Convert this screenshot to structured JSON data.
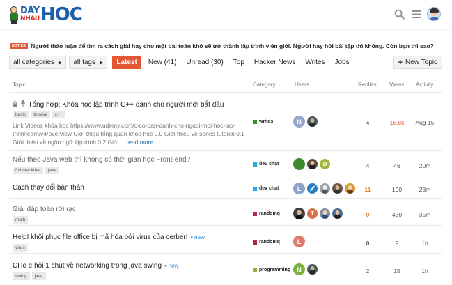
{
  "header": {
    "logo": {
      "day": "DAY",
      "nhau": "NHAU",
      "hoc": "HOC"
    },
    "icons": [
      "search-icon",
      "menu-icon",
      "user-avatar"
    ]
  },
  "notice": {
    "badge": "NOTICE",
    "text": "Người thảo luận để tìm ra cách giải hay cho một bài toán khó sẽ trở thành lập trình viên giỏi. Người hay hỏi bài tập thì không. Còn bạn thì sao?"
  },
  "nav": {
    "categories_label": "all categories",
    "tags_label": "all tags",
    "tabs": [
      "Latest",
      "New (41)",
      "Unread (30)",
      "Top",
      "Hacker News",
      "Writes",
      "Jobs"
    ],
    "new_topic_label": "New Topic"
  },
  "table": {
    "headers": {
      "topic": "Topic",
      "category": "Category",
      "users": "Users",
      "replies": "Replies",
      "views": "Views",
      "activity": "Activity"
    },
    "rows": [
      {
        "title": "Tổng hợp: Khóa học lập trình C++ dành cho người mới bắt đầu",
        "pinned": true,
        "tags": [
          "basic",
          "tutorial",
          "c++"
        ],
        "excerpt": "Link Videos khóa học https://www.udemy.com/c-co-ban-danh-cho-nguoi-moi-hoc-lap-trinh/learn/v4/overview Giới thiệu tổng quan khóa học 0.0 Giới thiệu về series tutorial 0.1 Giới thiệu về ngôn ngữ lập trình 0.2 Giới…",
        "read_more": "read more",
        "category": "writes",
        "replies": "4",
        "views": "16.8k",
        "activity": "Aug 15"
      },
      {
        "title": "Nếu theo Java web thì không có thời gian học Front-end?",
        "tags": [
          "full-stackdev",
          "java"
        ],
        "category": "dev chat",
        "replies": "4",
        "views": "46",
        "activity": "20m"
      },
      {
        "title": "Cách thay đổi bản thân",
        "tags": [],
        "category": "dev chat",
        "replies": "11",
        "views": "190",
        "activity": "23m"
      },
      {
        "title": "Giải đáp toán rời rạc",
        "tags": [
          "math"
        ],
        "category": "randomq",
        "replies": "9",
        "views": "430",
        "activity": "35m"
      },
      {
        "title": "Help! khôi phục file office bị mã hóa bởi virus của cerber!",
        "new_label": "new",
        "tags": [
          "virus"
        ],
        "category": "randomq",
        "replies": "0",
        "views": "9",
        "activity": "1h"
      },
      {
        "title": "CHo e hỏi 1 chút về networking trong java swing",
        "new_label": "new",
        "tags": [
          "swing",
          "java"
        ],
        "category": "programming",
        "replies": "2",
        "views": "15",
        "activity": "1h"
      }
    ],
    "avatars": {
      "row0": [
        "N"
      ],
      "row1": [],
      "row2": [
        "L"
      ],
      "row3": [
        "T"
      ],
      "row4": [
        "L"
      ],
      "row5": [
        "N"
      ]
    }
  },
  "colors": {
    "accent": "#e45735",
    "writes": "#3d8b2e",
    "dev_chat": "#25aae1",
    "randomq": "#b3283b",
    "programming": "#92b331"
  }
}
